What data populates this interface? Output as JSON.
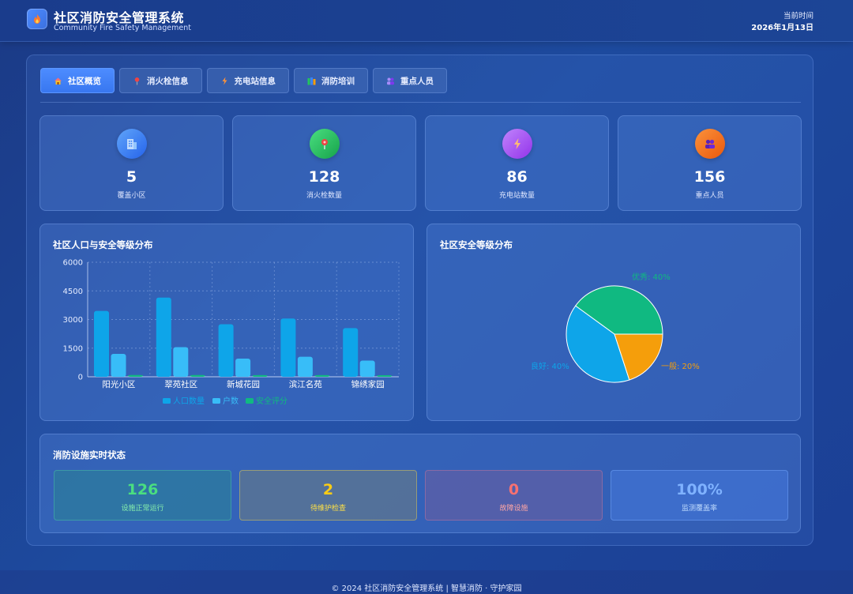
{
  "header": {
    "title": "社区消防安全管理系统",
    "subtitle": "Community Fire Safety Management",
    "time_label": "当前时间",
    "time_value": "2026年1月13日"
  },
  "tabs": [
    {
      "label": "社区概览",
      "icon": "house-icon",
      "active": true
    },
    {
      "label": "消火栓信息",
      "icon": "pin-icon",
      "active": false
    },
    {
      "label": "充电站信息",
      "icon": "lightning-icon",
      "active": false
    },
    {
      "label": "消防培训",
      "icon": "books-icon",
      "active": false
    },
    {
      "label": "重点人员",
      "icon": "people-icon",
      "active": false
    }
  ],
  "stats": [
    {
      "value": "5",
      "label": "覆盖小区",
      "icon": "building-icon",
      "color": "#3b82f6"
    },
    {
      "value": "128",
      "label": "消火栓数量",
      "icon": "pin-icon",
      "color": "#22c55e"
    },
    {
      "value": "86",
      "label": "充电站数量",
      "icon": "lightning-icon",
      "color": "#a855f7"
    },
    {
      "value": "156",
      "label": "重点人员",
      "icon": "people-icon",
      "color": "#f97316"
    }
  ],
  "bar_card": {
    "title": "社区人口与安全等级分布"
  },
  "pie_card": {
    "title": "社区安全等级分布"
  },
  "status_card": {
    "title": "消防设施实时状态",
    "items": [
      {
        "value": "126",
        "label": "设施正常运行",
        "color": "#4ade80"
      },
      {
        "value": "2",
        "label": "待维护检查",
        "color": "#facc15"
      },
      {
        "value": "0",
        "label": "故障设施",
        "color": "#f87171"
      },
      {
        "value": "100%",
        "label": "监测覆盖率",
        "color": "#60a5fa"
      }
    ]
  },
  "footer": "© 2024 社区消防安全管理系统 | 智慧消防 · 守护家园",
  "chart_data": [
    {
      "type": "bar",
      "categories": [
        "阳光小区",
        "翠苑社区",
        "新城花园",
        "滨江名苑",
        "锦绣家园"
      ],
      "series": [
        {
          "name": "人口数量",
          "values": [
            3450,
            4150,
            2750,
            3050,
            2550
          ],
          "color": "#0ea5e9"
        },
        {
          "name": "户数",
          "values": [
            1200,
            1550,
            950,
            1050,
            850
          ],
          "color": "#38bdf8"
        },
        {
          "name": "安全评分",
          "values": [
            95,
            92,
            88,
            90,
            85
          ],
          "color": "#10b981"
        }
      ],
      "yticks": [
        "0",
        "1500",
        "3000",
        "4500",
        "6000"
      ],
      "ylim": [
        0,
        6000
      ],
      "legend": "bottom",
      "grid": true
    },
    {
      "type": "pie",
      "slices": [
        {
          "label": "优秀",
          "value": 40,
          "text": "优秀: 40%",
          "color": "#10b981"
        },
        {
          "label": "良好",
          "value": 40,
          "text": "良好: 40%",
          "color": "#0ea5e9"
        },
        {
          "label": "一般",
          "value": 20,
          "text": "一般: 20%",
          "color": "#f59e0b"
        }
      ]
    }
  ]
}
